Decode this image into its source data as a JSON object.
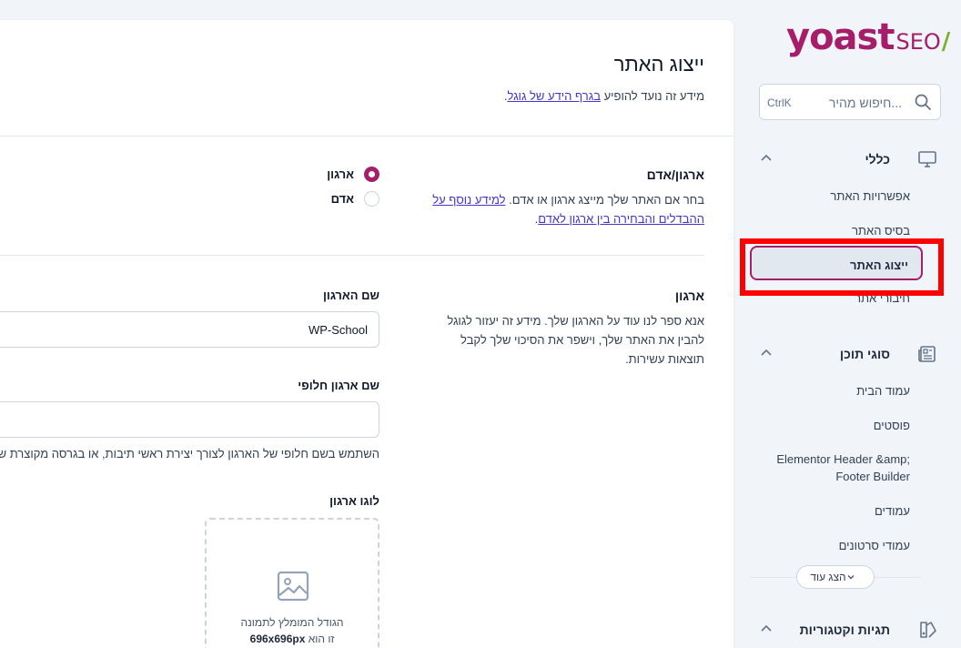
{
  "brand": {
    "logo_main": "yoast",
    "logo_suffix": "SEO",
    "logo_slash": "/",
    "brand_color": "#a61e69",
    "accent_color": "#77b227"
  },
  "search": {
    "placeholder": "חיפוש מהיר...",
    "shortcut": "CtrlK"
  },
  "sidebar": {
    "groups": [
      {
        "label": "כללי",
        "icon": "desktop-icon",
        "expanded": true,
        "items": [
          {
            "label": "אפשרויות האתר",
            "active": false
          },
          {
            "label": "בסיס האתר",
            "active": false
          },
          {
            "label": "ייצוג האתר",
            "active": true
          },
          {
            "label": "חיבורי אתר",
            "active": false
          }
        ]
      },
      {
        "label": "סוגי תוכן",
        "icon": "newspaper-icon",
        "expanded": true,
        "items": [
          {
            "label": "עמוד הבית"
          },
          {
            "label": "פוסטים"
          },
          {
            "label": "Elementor Header &amp; Footer Builder"
          },
          {
            "label": "עמודים"
          },
          {
            "label": "עמודי סרטונים"
          }
        ],
        "more_label": "הצג עוד"
      },
      {
        "label": "תגיות וקטגוריות",
        "icon": "tags-icon",
        "expanded": true
      }
    ]
  },
  "main": {
    "title": "ייצוג האתר",
    "desc_prefix": "מידע זה נועד להופיע ",
    "desc_link": "בגרף הידע של גוגל",
    "desc_suffix": ".",
    "type_section": {
      "title": "ארגון/אדם",
      "desc_prefix": "בחר אם האתר שלך מייצג ארגון או אדם. ",
      "desc_link": "למידע נוסף על ההבדלים והבחירה בין ארגון לאדם",
      "desc_suffix": ".",
      "options": [
        {
          "label": "ארגון",
          "checked": true
        },
        {
          "label": "אדם",
          "checked": false
        }
      ]
    },
    "org_section": {
      "title": "ארגון",
      "desc": "אנא ספר לנו עוד על הארגון שלך. מידע זה יעזור לגוגל להבין את האתר שלך, וישפר את הסיכוי שלך לקבל תוצאות עשירות.",
      "name_label": "שם הארגון",
      "name_value": "WP-School",
      "alt_label": "שם ארגון חלופי",
      "alt_value": "",
      "alt_help": "השתמש בשם חלופי של הארגון לצורך יצירת ראשי תיבות, או בגרסה מקוצרת של השם.",
      "logo_label": "לוגו ארגון",
      "logo_hint_1": "הגודל המומלץ לתמונה",
      "logo_hint_2": "זו הוא",
      "logo_hint_size": "696x696px"
    }
  }
}
